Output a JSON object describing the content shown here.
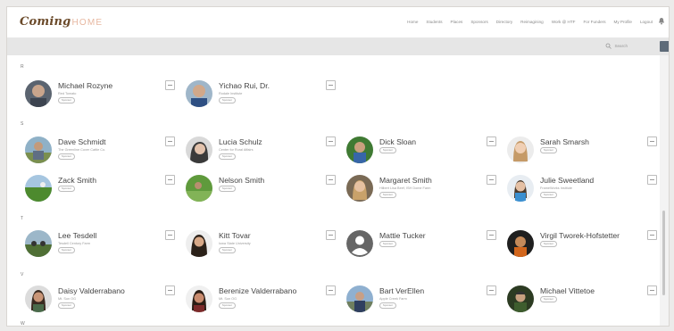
{
  "brand": {
    "logo_main": "Coming",
    "logo_home": "HOME"
  },
  "nav": {
    "items": [
      "Home",
      "Students",
      "Places",
      "Sponsors",
      "Directory",
      "Reimagining",
      "Work @ HTF",
      "For Funders",
      "My Profile",
      "Logout"
    ]
  },
  "search": {
    "placeholder": "Search"
  },
  "sections": [
    {
      "letter": "R"
    },
    {
      "letter": "S"
    },
    {
      "letter": "T"
    },
    {
      "letter": "V"
    },
    {
      "letter": "W"
    }
  ],
  "people": [
    {
      "name": "Michael Rozyne",
      "subtitle": "Red Tomato",
      "pill": "Sponsor"
    },
    {
      "name": "Yichao Rui, Dr.",
      "subtitle": "Rodale Institute",
      "pill": "Sponsor"
    },
    {
      "name": "Dave Schmidt",
      "subtitle": "The Greenline Cover Cattle Co.",
      "pill": "Sponsor"
    },
    {
      "name": "Lucia Schulz",
      "subtitle": "Center for Rural Affairs",
      "pill": "Sponsor"
    },
    {
      "name": "Dick Sloan",
      "subtitle": "",
      "pill": "Sponsor"
    },
    {
      "name": "Sarah Smarsh",
      "subtitle": "",
      "pill": "Sponsor"
    },
    {
      "name": "Zack Smith",
      "subtitle": "",
      "pill": "Sponsor"
    },
    {
      "name": "Nelson Smith",
      "subtitle": "",
      "pill": "Sponsor"
    },
    {
      "name": "Margaret Smith",
      "subtitle": "Hilbert Lisa Beef, ISH Dome Farm",
      "pill": "Sponsor"
    },
    {
      "name": "Julie Sweetland",
      "subtitle": "FrameWorks Institute",
      "pill": "Sponsor"
    },
    {
      "name": "Lee Tesdell",
      "subtitle": "Tesdell Century Farm",
      "pill": "Sponsor"
    },
    {
      "name": "Kitt Tovar",
      "subtitle": "Iowa State University",
      "pill": "Sponsor"
    },
    {
      "name": "Mattie Tucker",
      "subtitle": "",
      "pill": "Sponsor"
    },
    {
      "name": "Virgil Tworek-Hofstetter",
      "subtitle": "",
      "pill": "Sponsor"
    },
    {
      "name": "Daisy Valderrabano",
      "subtitle": "Mt. Sun OG",
      "pill": "Sponsor"
    },
    {
      "name": "Berenize Valderrabano",
      "subtitle": "Mt. Sun OG",
      "pill": "Sponsor"
    },
    {
      "name": "Bart VerEllen",
      "subtitle": "Apple Creek Farm",
      "pill": "Sponsor"
    },
    {
      "name": "Michael Vittetoe",
      "subtitle": "",
      "pill": "Sponsor"
    }
  ],
  "colors": {
    "accent": "#5e6b78",
    "brand_brown": "#6b4a2a",
    "brand_peach": "#e7b7a0"
  }
}
